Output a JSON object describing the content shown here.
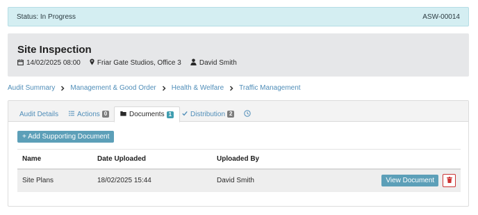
{
  "status": {
    "text": "Status: In Progress",
    "reference": "ASW-00014"
  },
  "header": {
    "title": "Site Inspection",
    "date": "14/02/2025 08:00",
    "location": "Friar Gate Studios, Office 3",
    "person": "David Smith"
  },
  "breadcrumb": {
    "items": [
      "Audit Summary",
      "Management & Good Order",
      "Health & Welfare",
      "Traffic Management"
    ]
  },
  "tabs": [
    {
      "label": "Audit Details",
      "icon": "none"
    },
    {
      "label": "Actions",
      "icon": "list-icon",
      "badge": "0"
    },
    {
      "label": "Documents",
      "icon": "folder-icon",
      "badge": "1",
      "active": true
    },
    {
      "label": "Distribution",
      "icon": "check-icon",
      "badge": "2"
    },
    {
      "label": "",
      "icon": "history-icon"
    }
  ],
  "documents": {
    "add_label": "+ Add Supporting Document",
    "columns": [
      "Name",
      "Date Uploaded",
      "Uploaded By"
    ],
    "rows": [
      {
        "name": "Site Plans",
        "date": "18/02/2025 15:44",
        "uploaded_by": "David Smith",
        "view_label": "View Document"
      }
    ]
  },
  "colors": {
    "accent": "#5c9fb8",
    "link": "#4f8db8",
    "status_bg": "#d4eef2",
    "danger": "#cc3333"
  }
}
